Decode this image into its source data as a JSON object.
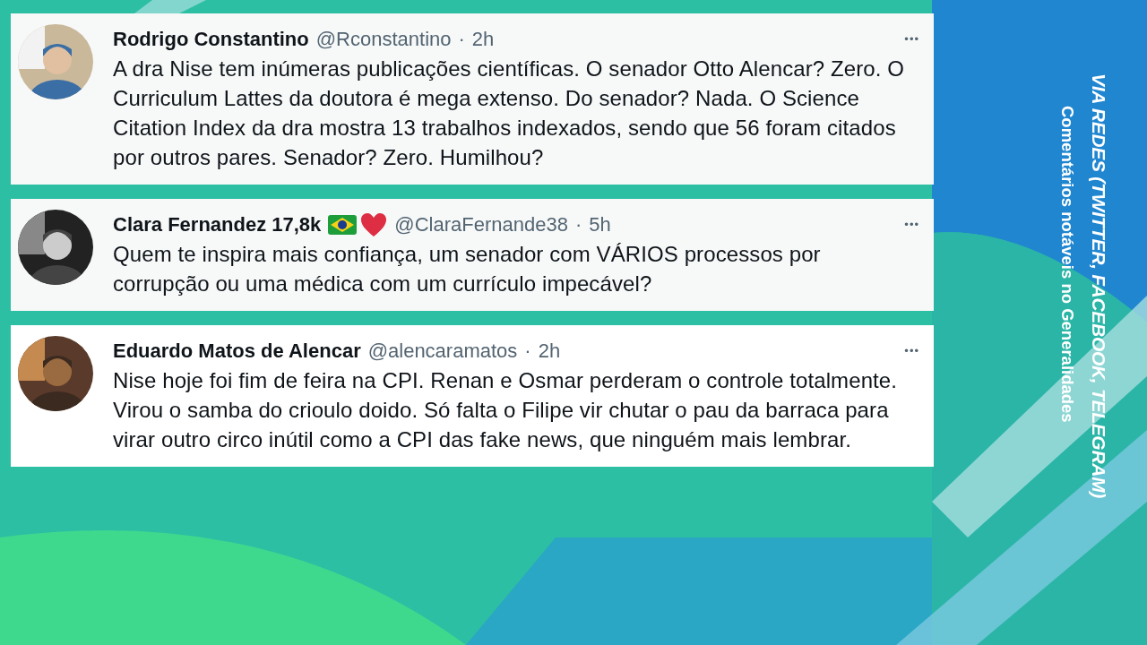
{
  "tweets": [
    {
      "name": "Rodrigo Constantino",
      "handle": "@Rconstantino",
      "sep": "·",
      "time": "2h",
      "emoji_badges": false,
      "more": "•••",
      "text": "A dra Nise tem inúmeras publicações científicas. O senador Otto Alencar? Zero. O Curriculum Lattes da doutora é mega extenso. Do senador? Nada. O Science Citation Index da dra mostra 13 trabalhos indexados, sendo que 56 foram citados por outros pares. Senador? Zero. Humilhou?"
    },
    {
      "name": "Clara Fernandez 17,8k",
      "handle": "@ClaraFernande38",
      "sep": "·",
      "time": "5h",
      "emoji_badges": true,
      "more": "•••",
      "text": "Quem te inspira mais confiança, um senador com VÁRIOS processos por corrupção ou uma médica com um currículo impecável?"
    },
    {
      "name": "Eduardo Matos de Alencar",
      "handle": "@alencaramatos",
      "sep": "·",
      "time": "2h",
      "emoji_badges": false,
      "more": "•••",
      "text": "Nise hoje foi fim de feira na CPI. Renan e Osmar perderam o controle totalmente. Virou o samba do crioulo doido. Só falta o Filipe vir chutar o pau da barraca para virar outro circo inútil como a CPI das fake news, que ninguém mais lembrar."
    }
  ],
  "side_banner": {
    "title": "VIA REDES (TWITTER, FACEBOOK, TELEGRAM)",
    "subtitle": "Comentários notáveis no Generalidades"
  }
}
